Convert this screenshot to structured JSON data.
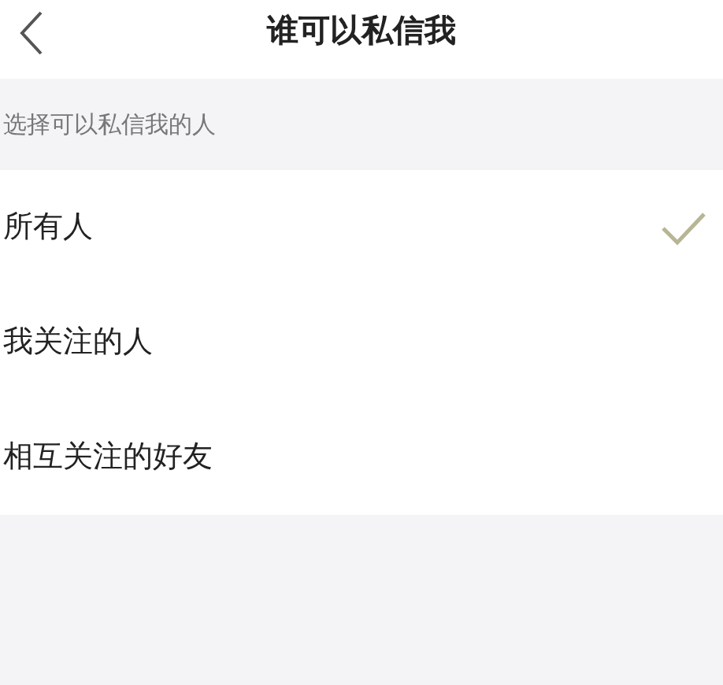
{
  "header": {
    "title": "谁可以私信我"
  },
  "section": {
    "label": "选择可以私信我的人"
  },
  "options": [
    {
      "label": "所有人",
      "selected": true
    },
    {
      "label": "我关注的人",
      "selected": false
    },
    {
      "label": "相互关注的好友",
      "selected": false
    }
  ]
}
